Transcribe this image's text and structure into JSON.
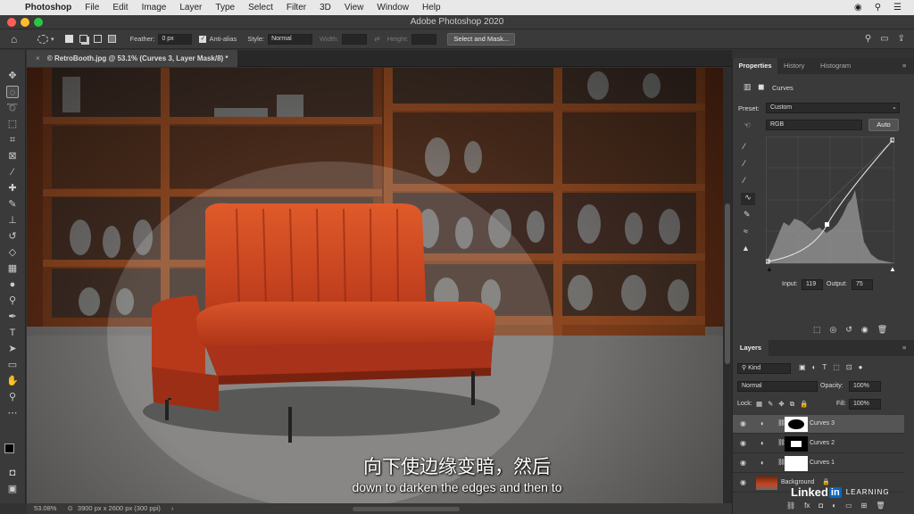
{
  "menubar": {
    "apple": "",
    "app": "Photoshop",
    "items": [
      "File",
      "Edit",
      "Image",
      "Layer",
      "Type",
      "Select",
      "Filter",
      "3D",
      "View",
      "Window",
      "Help"
    ]
  },
  "window": {
    "title": "Adobe Photoshop 2020"
  },
  "options": {
    "feather_label": "Feather:",
    "feather_value": "0 px",
    "antialias_label": "Anti-alias",
    "style_label": "Style:",
    "style_value": "Normal",
    "width_label": "Width:",
    "height_label": "Height:",
    "select_mask": "Select and Mask..."
  },
  "document": {
    "tab": "© RetroBooth.jpg @ 53.1% (Curves 3, Layer Mask/8) *",
    "close": "×"
  },
  "status": {
    "zoom": "53.08%",
    "info": "3900 px x 2600 px (300 ppi)"
  },
  "properties": {
    "tabs": [
      "Properties",
      "History",
      "Histogram"
    ],
    "title": "Curves",
    "preset_label": "Preset:",
    "preset_value": "Custom",
    "channel": "RGB",
    "auto": "Auto",
    "input_label": "Input:",
    "input_value": "119",
    "output_label": "Output:",
    "output_value": "75"
  },
  "layers": {
    "title": "Layers",
    "kind": "Kind",
    "blend": "Normal",
    "opacity_label": "Opacity:",
    "opacity_value": "100%",
    "lock_label": "Lock:",
    "fill_label": "Fill:",
    "fill_value": "100%",
    "items": [
      {
        "name": "Curves 3"
      },
      {
        "name": "Curves 2"
      },
      {
        "name": "Curves 1"
      },
      {
        "name": "Background"
      }
    ]
  },
  "captions": {
    "zh": "向下使边缘变暗，然后",
    "en": "down to darken the edges and then to"
  },
  "watermark": {
    "brand": "Linked",
    "in": "in",
    "learning": "LEARNING"
  },
  "colors": {
    "sofa": "#c8431f",
    "accent": "#1473e6"
  }
}
